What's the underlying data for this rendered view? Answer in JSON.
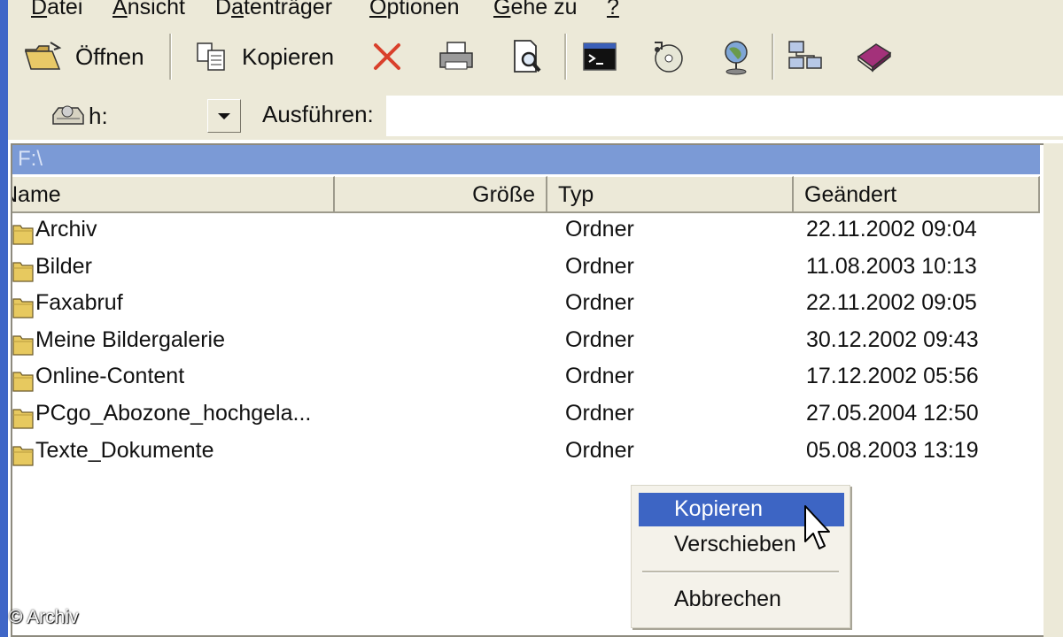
{
  "menu": [
    {
      "label": "Datei",
      "underline_index": 0
    },
    {
      "label": "Ansicht",
      "underline_index": 0
    },
    {
      "label": "Datenträger",
      "underline_index": 1
    },
    {
      "label": "Optionen",
      "underline_index": 0
    },
    {
      "label": "Gehe zu",
      "underline_index": 0
    },
    {
      "label": "?",
      "underline_index": 0
    }
  ],
  "toolbar": {
    "open_label": "Öffnen",
    "copy_label": "Kopieren",
    "icons": [
      "open-folder-icon",
      "copy-icon",
      "delete-icon",
      "print-icon",
      "print-preview-icon",
      "command-prompt-icon",
      "cd-icon",
      "network-globe-icon",
      "network-icon",
      "help-book-icon"
    ]
  },
  "commandbar": {
    "drive_value": "h:",
    "run_label": "Ausführen:",
    "run_value": ""
  },
  "file_panel": {
    "path": "F:\\",
    "columns": {
      "name": "Name",
      "size": "Größe",
      "type": "Typ",
      "modified": "Geändert"
    },
    "rows": [
      {
        "name": "Archiv",
        "type": "Ordner",
        "modified": "22.11.2002 09:04"
      },
      {
        "name": "Bilder",
        "type": "Ordner",
        "modified": "11.08.2003 10:13"
      },
      {
        "name": "Faxabruf",
        "type": "Ordner",
        "modified": "22.11.2002 09:05"
      },
      {
        "name": "Meine Bildergalerie",
        "type": "Ordner",
        "modified": "30.12.2002 09:43"
      },
      {
        "name": "Online-Content",
        "type": "Ordner",
        "modified": "17.12.2002 05:56"
      },
      {
        "name": "PCgo_Abozone_hochgela...",
        "type": "Ordner",
        "modified": "27.05.2004 12:50"
      },
      {
        "name": "Texte_Dokumente",
        "type": "Ordner",
        "modified": "05.08.2003 13:19"
      }
    ]
  },
  "context_menu": {
    "items": [
      "Kopieren",
      "Verschieben",
      "Abbrechen"
    ],
    "highlighted_index": 0
  },
  "watermark": "© Archiv",
  "colors": {
    "chrome": "#ece9d8",
    "path_bar": "#7b9ad6",
    "highlight": "#3d65c4",
    "folder": "#e7c95f"
  }
}
